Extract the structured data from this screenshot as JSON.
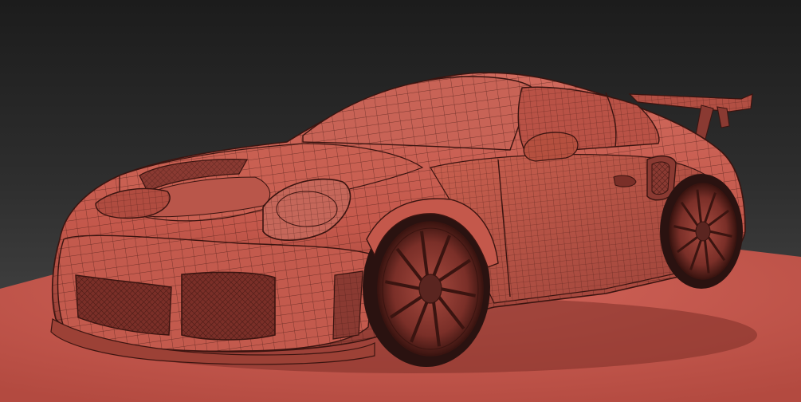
{
  "scene": {
    "subject": "sports-car-wireframe-render",
    "colors": {
      "background_top": "#1c1c1c",
      "background_bottom": "#444444",
      "floor": "#c9574b",
      "body": "#c4584b",
      "body_shadow": "#8a3a32",
      "wire": "#3a1410",
      "glass": "#b95246",
      "tire": "#2a1210"
    }
  }
}
